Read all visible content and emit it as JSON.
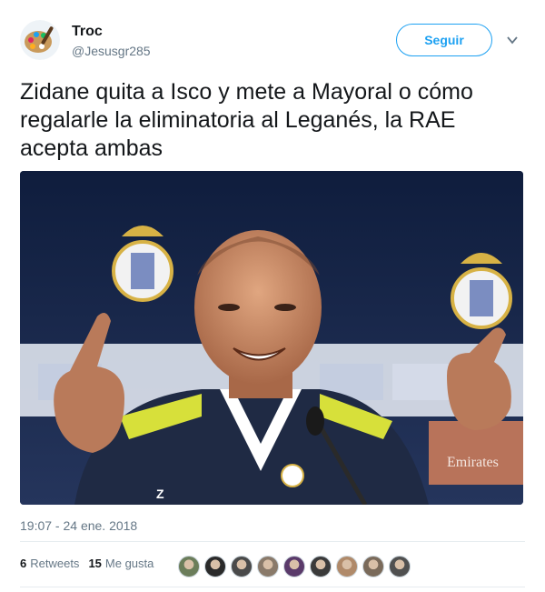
{
  "user": {
    "name": "Troc",
    "handle": "@Jesusgr285"
  },
  "follow_button": {
    "label": "Seguir"
  },
  "tweet": {
    "text": "Zidane quita a Isco y mete a Mayoral o cómo regalarle la eliminatoria al Leganés, la RAE acepta ambas",
    "timestamp": "19:07 - 24 ene. 2018"
  },
  "stats": {
    "retweets_count": "6",
    "retweets_label": "Retweets",
    "likes_count": "15",
    "likes_label": "Me gusta"
  },
  "media": {
    "jersey_text": "Z",
    "sponsor_text": "Emirates"
  },
  "likers": [
    {
      "color": "#6b7d5a"
    },
    {
      "color": "#2a2a2a"
    },
    {
      "color": "#4a4a4a"
    },
    {
      "color": "#8a7a6a"
    },
    {
      "color": "#5a3a6a"
    },
    {
      "color": "#3a3a3a"
    },
    {
      "color": "#b08a6a"
    },
    {
      "color": "#7a6a5a"
    },
    {
      "color": "#505050"
    }
  ],
  "colors": {
    "accent": "#1da1f2",
    "text": "#14171a",
    "muted": "#657786",
    "backdrop": "#1b2a4e"
  }
}
